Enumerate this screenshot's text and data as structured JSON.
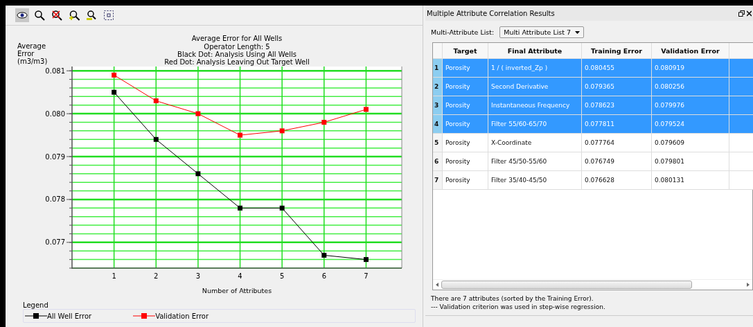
{
  "toolbar": {
    "tools": [
      {
        "kind": "eye",
        "selected": true
      },
      {
        "kind": "zoom",
        "selected": false
      },
      {
        "kind": "zoom-reset",
        "selected": false
      },
      {
        "kind": "zoom-in",
        "selected": false
      },
      {
        "kind": "zoom-out",
        "selected": false
      },
      {
        "kind": "fit",
        "selected": false
      }
    ]
  },
  "chart": {
    "subtitles": [
      "Operator Length: 5",
      "Black Dot: Analysis Using All Wells",
      "Red Dot: Analysis Leaving Out Target Well"
    ],
    "chart_data": {
      "type": "line",
      "title": "Average Error for All Wells",
      "xlabel": "Number of Attributes",
      "ylabel": "Average Error (m3/m3)",
      "x": [
        1,
        2,
        3,
        4,
        5,
        6,
        7
      ],
      "xlim": [
        0,
        7.85
      ],
      "ylim": [
        0.0764,
        0.0811
      ],
      "xticks": [
        1,
        2,
        3,
        4,
        5,
        6,
        7
      ],
      "yticks": [
        {
          "value": 0.077,
          "label": "0.077"
        },
        {
          "value": 0.078,
          "label": "0.078"
        },
        {
          "value": 0.079,
          "label": "0.079"
        },
        {
          "value": 0.08,
          "label": "0.080"
        },
        {
          "value": 0.081,
          "label": "0.081"
        }
      ],
      "series": [
        {
          "name": "All Well Error",
          "color": "#000000",
          "marker": "square",
          "values": [
            0.0805,
            0.0794,
            0.0786,
            0.0778,
            0.0778,
            0.0767,
            0.0766
          ]
        },
        {
          "name": "Validation Error",
          "color": "#ff0000",
          "marker": "square",
          "values": [
            0.0809,
            0.0803,
            0.08,
            0.0795,
            0.0796,
            0.0798,
            0.0801
          ]
        }
      ],
      "grid": true
    },
    "legend_title": "Legend"
  },
  "results": {
    "title": "Multiple Attribute Correlation Results",
    "list_label": "Multi-Attribute List:",
    "list_value": "Multi Attribute List 7",
    "columns": [
      "Target",
      "Final Attribute",
      "Training Error",
      "Validation Error"
    ],
    "rows": [
      {
        "index": "1",
        "target": "Porosity",
        "attribute": "1 / ( inverted_Zp )",
        "training": "0.080455",
        "validation": "0.080919",
        "selected": true
      },
      {
        "index": "2",
        "target": "Porosity",
        "attribute": "Second Derivative",
        "training": "0.079365",
        "validation": "0.080256",
        "selected": true
      },
      {
        "index": "3",
        "target": "Porosity",
        "attribute": "Instantaneous Frequency",
        "training": "0.078623",
        "validation": "0.079976",
        "selected": true
      },
      {
        "index": "4",
        "target": "Porosity",
        "attribute": "Filter 55/60-65/70",
        "training": "0.077811",
        "validation": "0.079524",
        "selected": true
      },
      {
        "index": "5",
        "target": "Porosity",
        "attribute": "X-Coordinate",
        "training": "0.077764",
        "validation": "0.079609",
        "selected": false
      },
      {
        "index": "6",
        "target": "Porosity",
        "attribute": "Filter 45/50-55/60",
        "training": "0.076749",
        "validation": "0.079801",
        "selected": false
      },
      {
        "index": "7",
        "target": "Porosity",
        "attribute": "Filter 35/40-45/50",
        "training": "0.076628",
        "validation": "0.080131",
        "selected": false
      }
    ],
    "notes": [
      "There are 7 attributes (sorted by the Training Error).",
      "--- Validation criterion was used in step-wise regression."
    ]
  }
}
